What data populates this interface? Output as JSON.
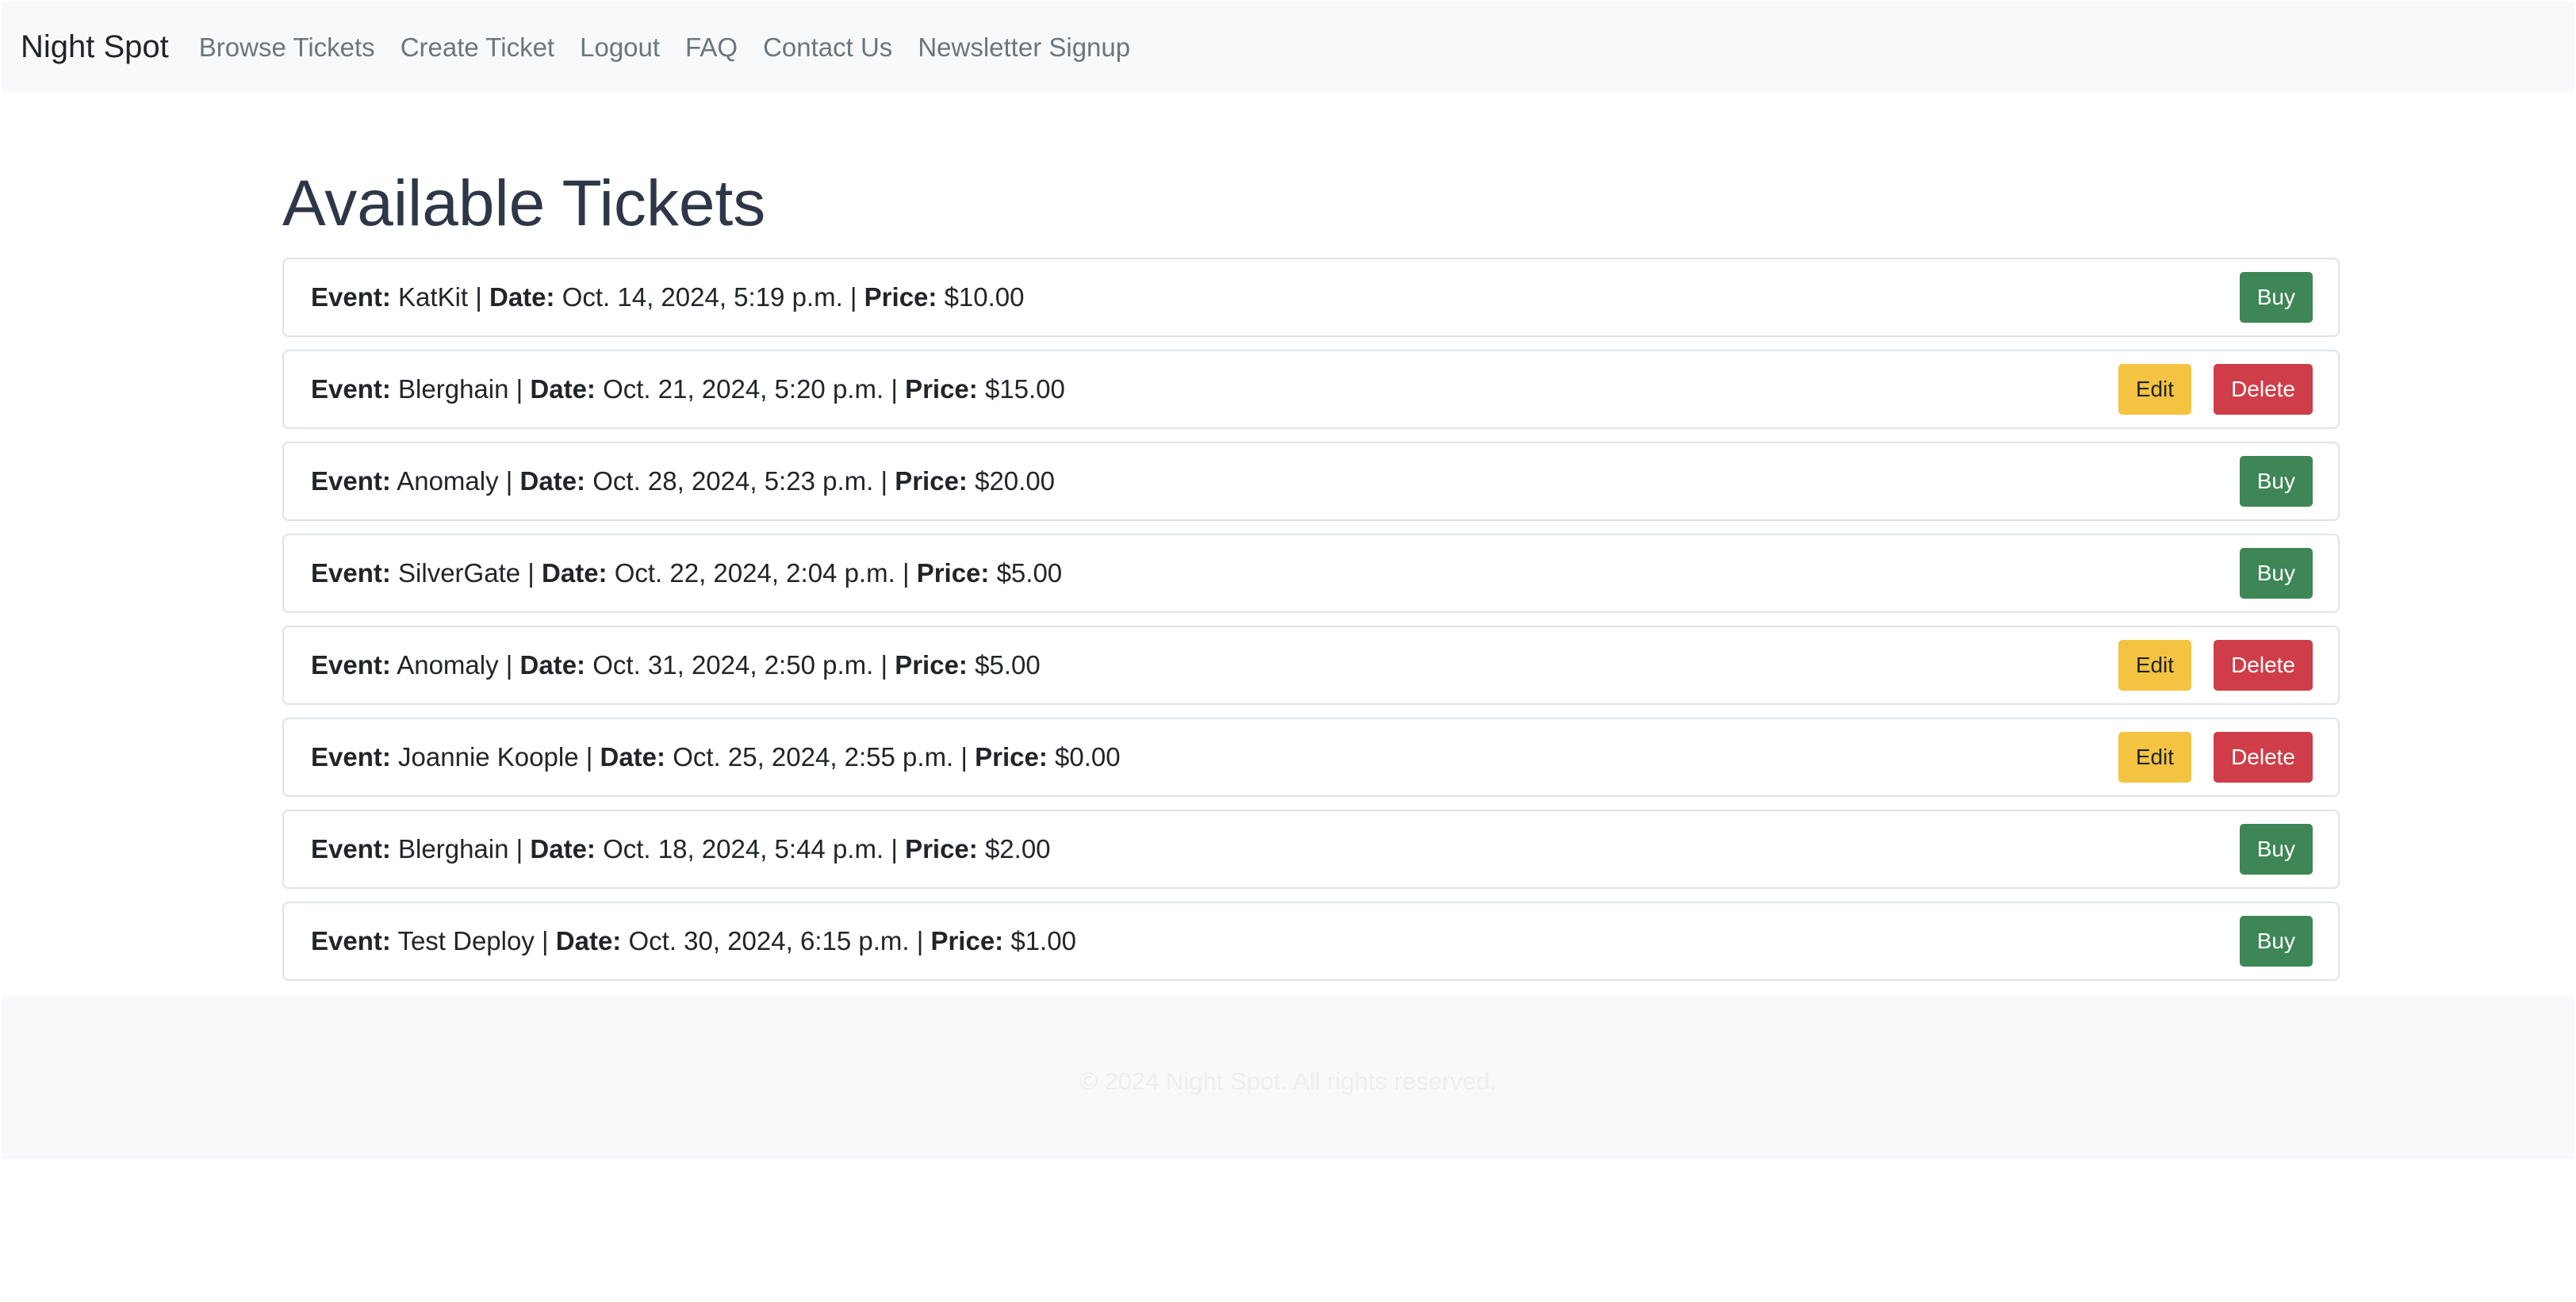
{
  "navbar": {
    "brand": "Night Spot",
    "links": [
      "Browse Tickets",
      "Create Ticket",
      "Logout",
      "FAQ",
      "Contact Us",
      "Newsletter Signup"
    ]
  },
  "main": {
    "title": "Available Tickets",
    "labels": {
      "event": "Event:",
      "date": "Date:",
      "price": "Price:",
      "separator": "|"
    },
    "buttons": {
      "buy": "Buy",
      "edit": "Edit",
      "delete": "Delete"
    },
    "tickets": [
      {
        "event": "KatKit",
        "date": "Oct. 14, 2024, 5:19 p.m.",
        "price": "$10.00",
        "actions": "buy"
      },
      {
        "event": "Blerghain",
        "date": "Oct. 21, 2024, 5:20 p.m.",
        "price": "$15.00",
        "actions": "owner"
      },
      {
        "event": "Anomaly",
        "date": "Oct. 28, 2024, 5:23 p.m.",
        "price": "$20.00",
        "actions": "buy"
      },
      {
        "event": "SilverGate",
        "date": "Oct. 22, 2024, 2:04 p.m.",
        "price": "$5.00",
        "actions": "buy"
      },
      {
        "event": "Anomaly",
        "date": "Oct. 31, 2024, 2:50 p.m.",
        "price": "$5.00",
        "actions": "owner"
      },
      {
        "event": "Joannie Koople",
        "date": "Oct. 25, 2024, 2:55 p.m.",
        "price": "$0.00",
        "actions": "owner"
      },
      {
        "event": "Blerghain",
        "date": "Oct. 18, 2024, 5:44 p.m.",
        "price": "$2.00",
        "actions": "buy"
      },
      {
        "event": "Test Deploy",
        "date": "Oct. 30, 2024, 6:15 p.m.",
        "price": "$1.00",
        "actions": "buy"
      }
    ]
  },
  "footer": {
    "text": "© 2024 Night Spot. All rights reserved."
  },
  "colors": {
    "navbar_bg": "#f8f9fa",
    "buy": "#3e8656",
    "edit": "#f5c342",
    "delete": "#cf3e48",
    "title": "#2d3748"
  }
}
